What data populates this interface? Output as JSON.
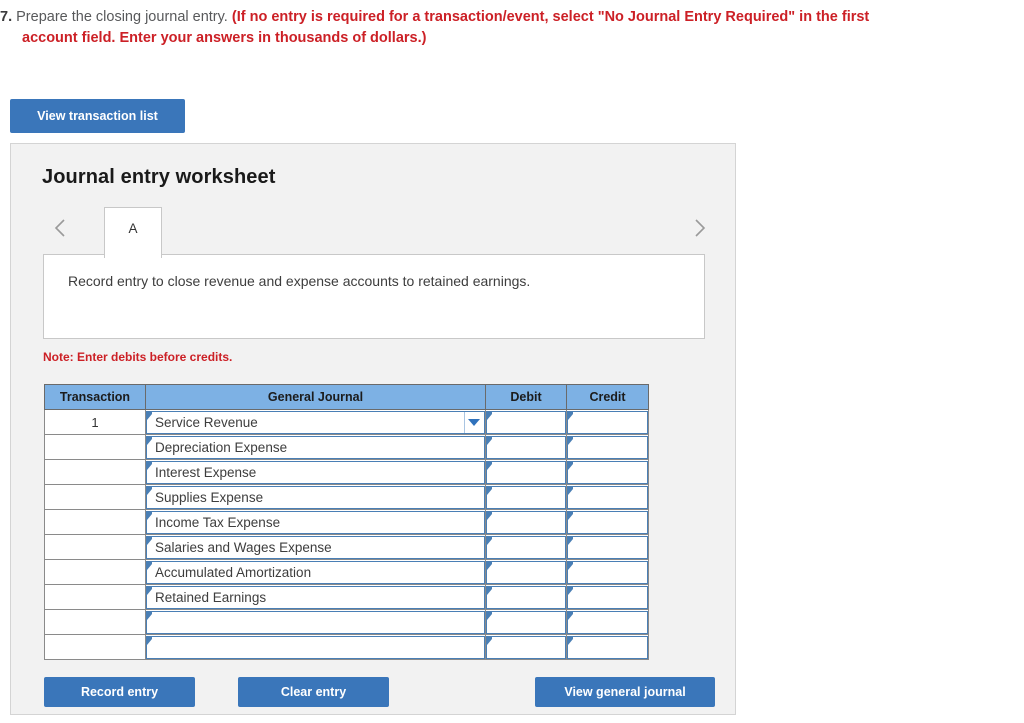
{
  "question": {
    "number": "7.",
    "text": "Prepare the closing journal entry.",
    "bold_part": "(If no entry is required for a transaction/event, select \"No Journal Entry Required\" in the first",
    "bold_part_line2": "account field. Enter your answers in thousands of dollars.)"
  },
  "toolbar": {
    "view_transaction_list_label": "View transaction list"
  },
  "worksheet": {
    "title": "Journal entry worksheet",
    "tabs": [
      {
        "label": "A",
        "active": true
      }
    ],
    "prev_arrow_icon": "chevron-left-icon",
    "next_arrow_icon": "chevron-right-icon",
    "description": "Record entry to close revenue and expense accounts to retained earnings.",
    "note": "Note: Enter debits before credits."
  },
  "table": {
    "headers": [
      "Transaction",
      "General Journal",
      "Debit",
      "Credit"
    ],
    "rows": [
      {
        "transaction": "1",
        "account": "Service Revenue",
        "debit": "",
        "credit": "",
        "has_dropdown": true
      },
      {
        "transaction": "",
        "account": "Depreciation Expense",
        "debit": "",
        "credit": "",
        "has_dropdown": false
      },
      {
        "transaction": "",
        "account": "Interest Expense",
        "debit": "",
        "credit": "",
        "has_dropdown": false
      },
      {
        "transaction": "",
        "account": "Supplies Expense",
        "debit": "",
        "credit": "",
        "has_dropdown": false
      },
      {
        "transaction": "",
        "account": "Income Tax Expense",
        "debit": "",
        "credit": "",
        "has_dropdown": false
      },
      {
        "transaction": "",
        "account": "Salaries and Wages Expense",
        "debit": "",
        "credit": "",
        "has_dropdown": false
      },
      {
        "transaction": "",
        "account": "Accumulated Amortization",
        "debit": "",
        "credit": "",
        "has_dropdown": false
      },
      {
        "transaction": "",
        "account": "Retained Earnings",
        "debit": "",
        "credit": "",
        "has_dropdown": false
      },
      {
        "transaction": "",
        "account": "",
        "debit": "",
        "credit": "",
        "has_dropdown": false
      },
      {
        "transaction": "",
        "account": "",
        "debit": "",
        "credit": "",
        "has_dropdown": false
      }
    ]
  },
  "actions": {
    "record_entry_label": "Record entry",
    "clear_entry_label": "Clear entry",
    "view_general_journal_label": "View general journal"
  },
  "colors": {
    "button_blue": "#3a76ba",
    "header_blue": "#7db1e4",
    "note_red": "#cc2026",
    "panel_gray": "#f2f2f2",
    "cell_border_blue": "#4a7fb5"
  }
}
